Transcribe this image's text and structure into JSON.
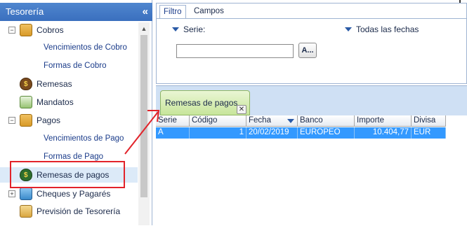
{
  "nav": {
    "title": "Tesorería",
    "collapse_glyph": "«",
    "items": [
      {
        "label": "Cobros",
        "expander": "−",
        "icon": "coins-box-icon"
      },
      {
        "label": "Vencimientos de Cobro"
      },
      {
        "label": "Formas de Cobro"
      },
      {
        "label": "Remesas",
        "icon": "money-bag-icon"
      },
      {
        "label": "Mandatos",
        "icon": "document-icon"
      },
      {
        "label": "Pagos",
        "expander": "−",
        "icon": "payment-box-icon"
      },
      {
        "label": "Vencimientos de Pago"
      },
      {
        "label": "Formas de Pago"
      },
      {
        "label": "Remesas de pagos",
        "icon": "money-bag-icon",
        "selected": true
      },
      {
        "label": "Cheques y Pagarés",
        "expander": "+",
        "icon": "cheque-icon"
      },
      {
        "label": "Previsión de Tesorería",
        "icon": "forecast-icon"
      }
    ]
  },
  "filter": {
    "tabs": [
      "Filtro",
      "Campos"
    ],
    "serie_label": "Serie:",
    "dates_label": "Todas las fechas",
    "serie_value": "",
    "ellipsis_label": "A..."
  },
  "panel": {
    "tab_label": "Remesas de pagos",
    "close_glyph": "✕",
    "columns": [
      "Serie",
      "Código",
      "Fecha",
      "Banco",
      "Importe",
      "Divisa"
    ],
    "rows": [
      [
        "A",
        "1",
        "20/02/2019",
        "EUROPEO",
        "10.404,77",
        "EUR"
      ]
    ]
  },
  "colors": {
    "accent": "#3a6fbe",
    "selection": "#3399ff",
    "highlight": "#e2232a",
    "tab_green": "#c7e59b"
  }
}
